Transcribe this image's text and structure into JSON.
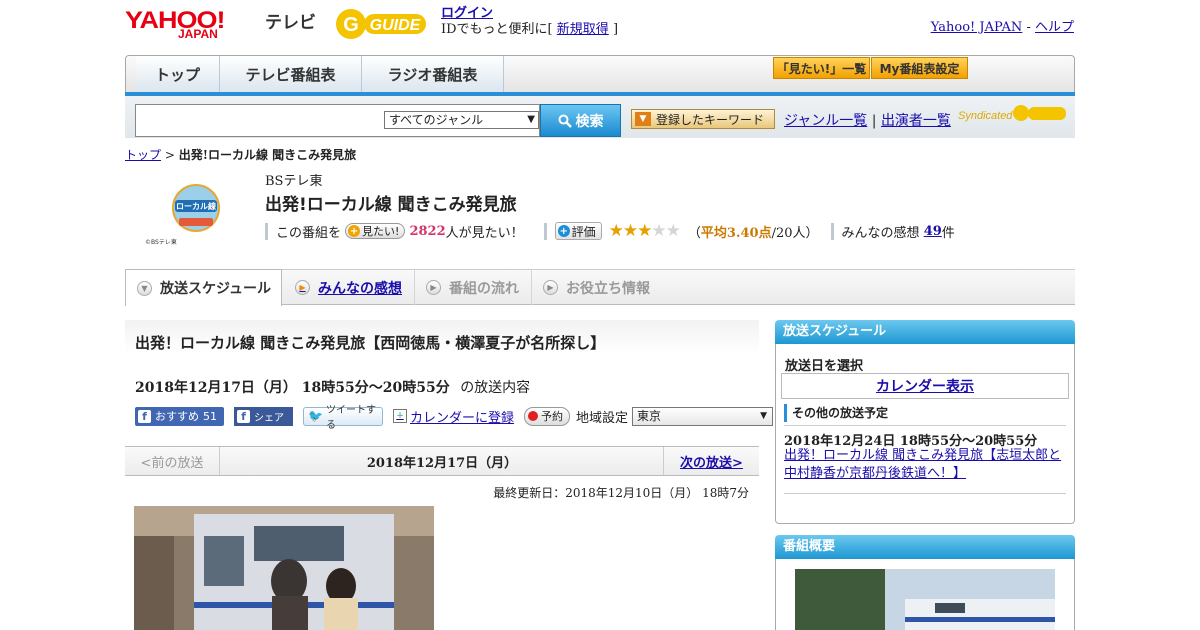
{
  "header": {
    "logo_yahoo": "YAHOO!",
    "logo_japan": "JAPAN",
    "logo_tv": "テレビ",
    "gguide_label": "GUIDE",
    "login_label": "ログイン",
    "login_desc_prefix": "IDでもっと便利に[",
    "register_label": "新規取得",
    "login_desc_suffix": "]",
    "yahoo_japan_link": "Yahoo! JAPAN",
    "separator": " - ",
    "help_link": "ヘルプ"
  },
  "nav": {
    "tabs": [
      "トップ",
      "テレビ番組表",
      "ラジオ番組表"
    ],
    "mitai_list": "「見たい!」一覧",
    "my_settings": "My番組表設定"
  },
  "search": {
    "placeholder": "",
    "genre_selected": "すべてのジャンル",
    "search_button": "検索",
    "keyword_button": "登録したキーワード",
    "genre_list": "ジャンル一覧",
    "divider": "|",
    "performer_list": "出演者一覧",
    "syndicated": "Syndicated"
  },
  "breadcrumb": {
    "top": "トップ",
    "sep": " > ",
    "current": "出発!ローカル線 聞きこみ発見旅"
  },
  "program": {
    "logo_text_1": "ローカル線",
    "logo_caption": "©BSテレ東",
    "channel": "BSテレ東",
    "title": "出発!ローカル線 聞きこみ発見旅",
    "mitai_prefix": "この番組を",
    "mitai_button": "見たい!",
    "mitai_count": "2822",
    "mitai_suffix": "人が見たい！",
    "hyoka_button": "評価",
    "rating": 3.4,
    "avg_open": "（",
    "avg_label": "平均3.40点",
    "avg_people": "/20人）",
    "kanso_label": "みんなの感想",
    "kanso_count": "49",
    "kanso_unit": "件"
  },
  "tabs": {
    "schedule": "放送スケジュール",
    "impressions": "みんなの感想",
    "flow": "番組の流れ",
    "useful": "お役立ち情報"
  },
  "episode": {
    "title": "出発！ローカル線 聞きこみ発見旅【西岡徳馬・横澤夏子が名所探し】",
    "datetime": "2018年12月17日（月） 18時55分～20時55分",
    "datetime_suffix": "の放送内容",
    "fb_recommend": "おすすめ",
    "fb_count": "51",
    "fb_share": "シェア",
    "tweet": "ツイートする",
    "calendar_register": "カレンダーに登録",
    "reserve": "予約",
    "region_label": "地域設定",
    "region_value": "東京",
    "prev": "<前の放送",
    "current_date": "2018年12月17日（月）",
    "next": "次の放送>",
    "updated": "最終更新日：2018年12月10日（月） 18時7分"
  },
  "sidebar": {
    "schedule_head": "放送スケジュール",
    "select_date": "放送日を選択",
    "calendar_view": "カレンダー表示",
    "other_head": "その他の放送予定",
    "other_date": "2018年12月24日 18時55分～20時55分",
    "other_link": "出発！ローカル線 聞きこみ発見旅【志垣太郎と中村静香が京都丹後鉄道へ！】",
    "overview_head": "番組概要"
  }
}
